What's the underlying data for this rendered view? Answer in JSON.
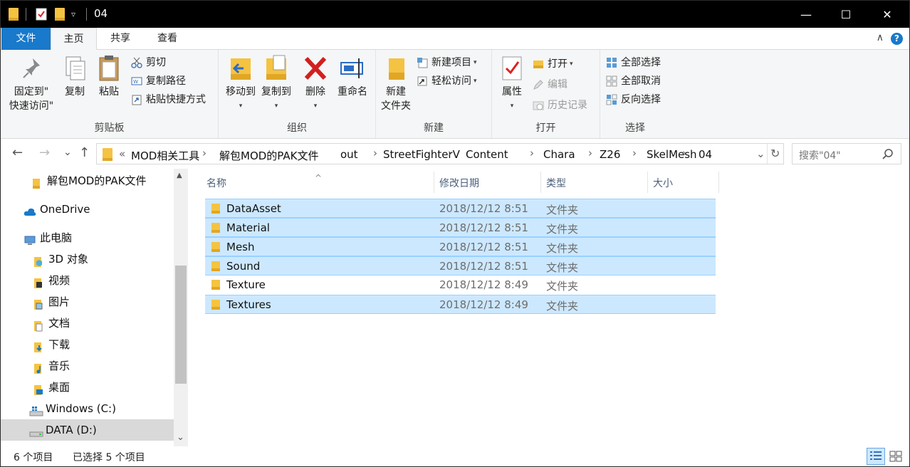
{
  "window": {
    "title": "04",
    "minimize_glyph": "—",
    "maximize_glyph": "☐",
    "close_glyph": "✕",
    "qa_caret": "▿"
  },
  "ribbon_tabs": {
    "file": "文件",
    "home": "主页",
    "share": "共享",
    "view": "查看",
    "collapse_glyph": "∧",
    "help": "?"
  },
  "ribbon": {
    "clipboard": {
      "label": "剪贴板",
      "pin_line1": "固定到\"",
      "pin_line2": "快速访问\"",
      "copy": "复制",
      "paste": "粘贴",
      "cut": "剪切",
      "copy_path": "复制路径",
      "paste_shortcut": "粘贴快捷方式"
    },
    "organize": {
      "label": "组织",
      "move_to": "移动到",
      "copy_to": "复制到",
      "delete": "删除",
      "rename": "重命名"
    },
    "new": {
      "label": "新建",
      "new_folder_line1": "新建",
      "new_folder_line2": "文件夹",
      "new_item": "新建项目",
      "easy_access": "轻松访问"
    },
    "open": {
      "label": "打开",
      "properties": "属性",
      "open": "打开",
      "edit": "编辑",
      "history": "历史记录"
    },
    "select": {
      "label": "选择",
      "select_all": "全部选择",
      "select_none": "全部取消",
      "invert": "反向选择"
    }
  },
  "nav": {
    "back": "←",
    "forward": "→",
    "recent": "⌄",
    "up": "↑",
    "overflow": "«",
    "breadcrumbs": [
      "MOD相关工具",
      "解包MOD的PAK文件",
      "out",
      "StreetFighterV",
      "Content",
      "Chara",
      "Z26",
      "SkelMesh",
      "04"
    ],
    "crumb_sep": "›",
    "dropdown_glyph": "⌄",
    "refresh_glyph": "↻",
    "search_placeholder": "搜索\"04\""
  },
  "navpane": {
    "items": [
      {
        "label": "解包MOD的PAK文件",
        "icon": "folder-icon"
      },
      {
        "label": "OneDrive",
        "icon": "cloud-icon"
      },
      {
        "label": "此电脑",
        "icon": "computer-icon"
      },
      {
        "label": "3D 对象",
        "icon": "3d-objects-icon"
      },
      {
        "label": "视频",
        "icon": "video-icon"
      },
      {
        "label": "图片",
        "icon": "pictures-icon"
      },
      {
        "label": "文档",
        "icon": "documents-icon"
      },
      {
        "label": "下载",
        "icon": "downloads-icon"
      },
      {
        "label": "音乐",
        "icon": "music-icon"
      },
      {
        "label": "桌面",
        "icon": "desktop-icon"
      },
      {
        "label": "Windows (C:)",
        "icon": "drive-c-icon"
      },
      {
        "label": "DATA (D:)",
        "icon": "drive-d-icon"
      }
    ],
    "scroll_up": "▲",
    "scroll_down": "⌄"
  },
  "filelist": {
    "columns": {
      "name": "名称",
      "date": "修改日期",
      "type": "类型",
      "size": "大小"
    },
    "sort_glyph": "^",
    "rows": [
      {
        "name": "DataAsset",
        "date": "2018/12/12 8:51",
        "type": "文件夹",
        "selected": true
      },
      {
        "name": "Material",
        "date": "2018/12/12 8:51",
        "type": "文件夹",
        "selected": true
      },
      {
        "name": "Mesh",
        "date": "2018/12/12 8:51",
        "type": "文件夹",
        "selected": true
      },
      {
        "name": "Sound",
        "date": "2018/12/12 8:51",
        "type": "文件夹",
        "selected": true
      },
      {
        "name": "Texture",
        "date": "2018/12/12 8:49",
        "type": "文件夹",
        "selected": false
      },
      {
        "name": "Textures",
        "date": "2018/12/12 8:49",
        "type": "文件夹",
        "selected": true
      }
    ]
  },
  "status": {
    "count": "6 个项目",
    "selected": "已选择 5 个项目"
  },
  "colors": {
    "accent": "#1979ca",
    "selection": "#cce8ff",
    "folder": "#f5c342"
  }
}
